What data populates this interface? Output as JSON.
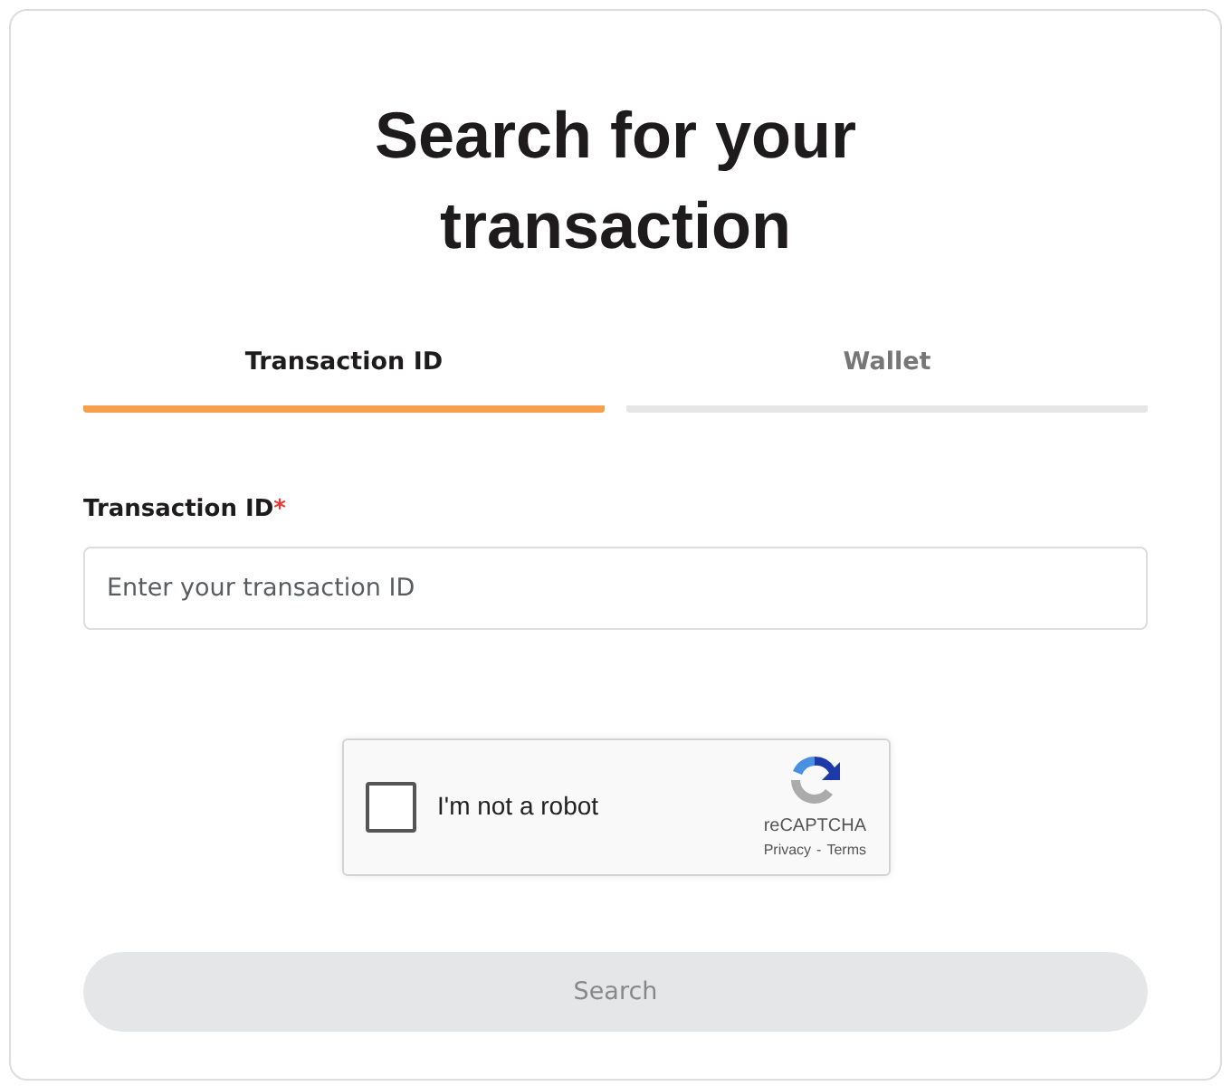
{
  "title": "Search for your transaction",
  "tabs": [
    {
      "label": "Transaction ID",
      "selected": true
    },
    {
      "label": "Wallet",
      "selected": false
    }
  ],
  "field": {
    "label": "Transaction ID",
    "required_mark": "*",
    "placeholder": "Enter your transaction ID"
  },
  "captcha": {
    "label": "I'm not a robot",
    "checked": false,
    "brand": "reCAPTCHA",
    "privacy": "Privacy",
    "separator": "-",
    "terms": "Terms"
  },
  "submit": {
    "label": "Search",
    "disabled": true
  }
}
